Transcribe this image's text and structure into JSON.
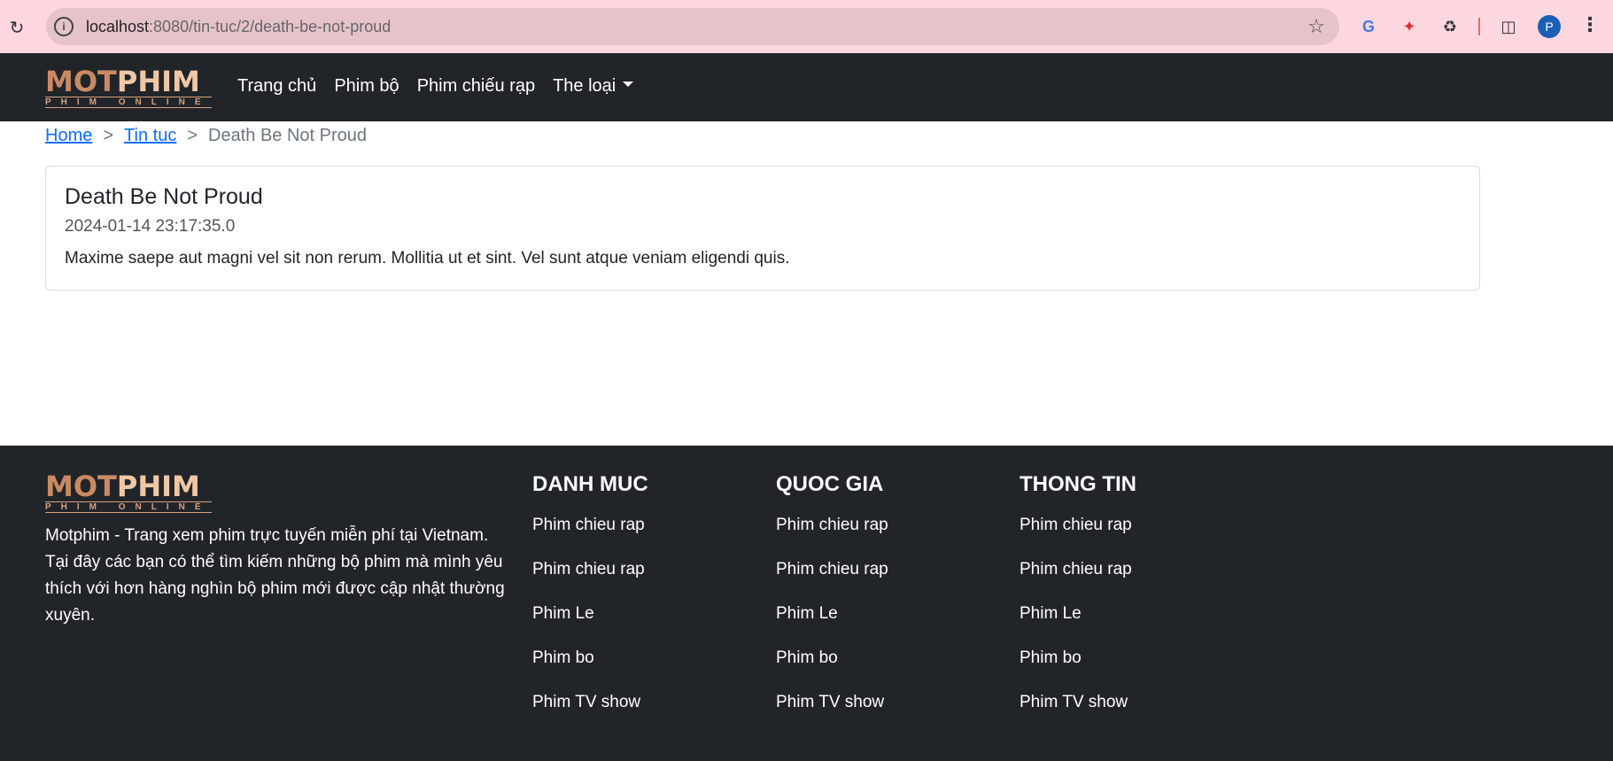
{
  "browser": {
    "url_host": "localhost",
    "url_path": ":8080/tin-tuc/2/death-be-not-proud",
    "profile_initial": "P",
    "icons": [
      "reload-icon",
      "site-info-icon",
      "bookmark-star-icon",
      "translate-icon",
      "color-picker-icon",
      "extensions-icon",
      "side-panel-icon",
      "menu-icon"
    ]
  },
  "logo": {
    "main_1": "MOT",
    "main_2": "PHIM",
    "sub": "PHIM ONLINE"
  },
  "nav": {
    "items": [
      "Trang chủ",
      "Phim bộ",
      "Phim chiếu rạp"
    ],
    "dropdown_label": "The loại"
  },
  "breadcrumb": {
    "home": "Home",
    "section": "Tin tuc",
    "current": "Death Be Not Proud",
    "separator": ">"
  },
  "article": {
    "title": "Death Be Not Proud",
    "date": "2024-01-14 23:17:35.0",
    "body": "Maxime saepe aut magni vel sit non rerum. Mollitia ut et sint. Vel sunt atque veniam eligendi quis."
  },
  "footer": {
    "description": "Motphim - Trang xem phim trực tuyến miễn phí tại Vietnam. Tại đây các bạn có thể tìm kiếm những bộ phim mà mình yêu thích với hơn hàng nghìn bộ phim mới được cập nhật thường xuyên.",
    "columns": [
      {
        "heading": "DANH MUC",
        "items": [
          "Phim chieu rap",
          "Phim chieu rap",
          "Phim Le",
          "Phim bo",
          "Phim TV show"
        ]
      },
      {
        "heading": "QUOC GIA",
        "items": [
          "Phim chieu rap",
          "Phim chieu rap",
          "Phim Le",
          "Phim bo",
          "Phim TV show"
        ]
      },
      {
        "heading": "THONG TIN",
        "items": [
          "Phim chieu rap",
          "Phim chieu rap",
          "Phim Le",
          "Phim bo",
          "Phim TV show"
        ]
      }
    ]
  },
  "colors": {
    "chrome_bg": "#fdd7df",
    "dark_bg": "#212529",
    "link": "#0d6efd",
    "logo_accent": "#c98a63"
  }
}
